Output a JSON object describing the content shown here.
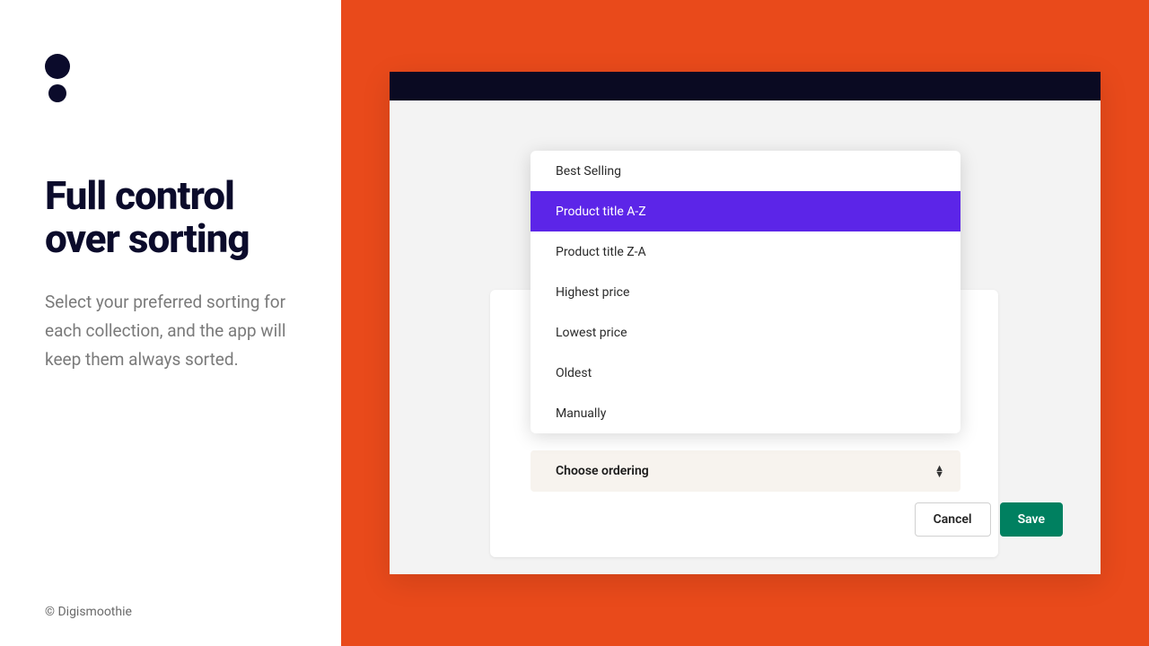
{
  "left": {
    "headline": "Full control over sorting",
    "subtext": "Select your preferred sorting for each collection, and the app will keep them always sorted.",
    "footer": "© Digismoothie"
  },
  "dropdown": {
    "items": [
      "Best Selling",
      "Product title A-Z",
      "Product title Z-A",
      "Highest price",
      "Lowest price",
      "Oldest",
      "Manually"
    ],
    "selected_index": 1
  },
  "select": {
    "label": "Choose ordering"
  },
  "buttons": {
    "cancel": "Cancel",
    "save": "Save"
  },
  "colors": {
    "accent_orange": "#e94a1b",
    "dropdown_selected": "#5c25e8",
    "save_button": "#008060",
    "dark": "#0b0b2b"
  }
}
